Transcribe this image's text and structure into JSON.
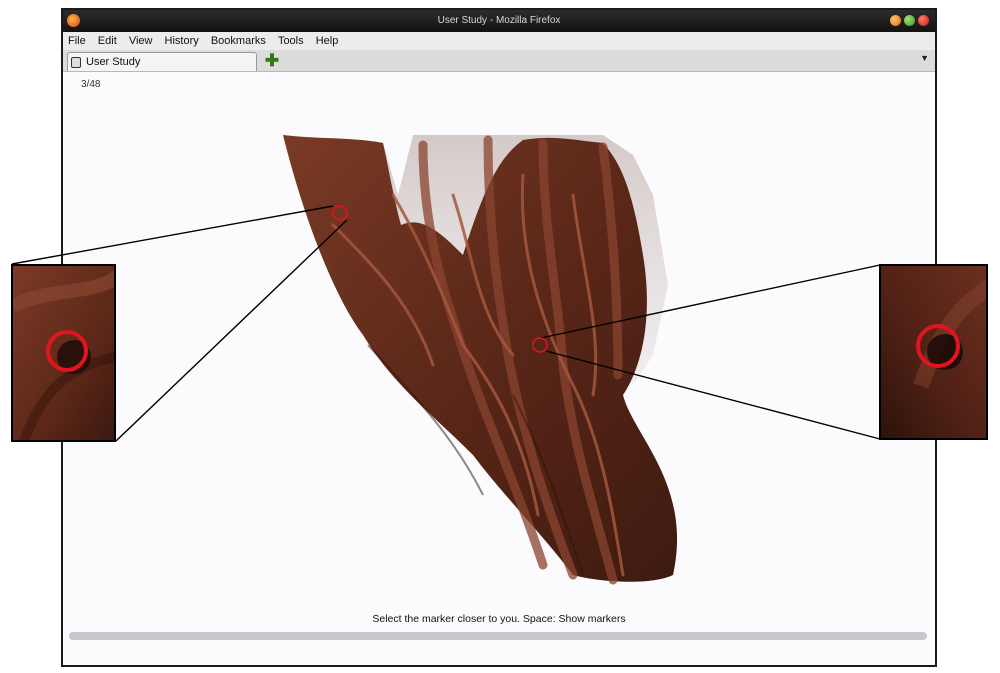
{
  "window": {
    "title": "User Study - Mozilla Firefox"
  },
  "menubar": {
    "items": [
      "File",
      "Edit",
      "View",
      "History",
      "Bookmarks",
      "Tools",
      "Help"
    ]
  },
  "tabs": [
    {
      "label": "User Study",
      "icon": "page-icon",
      "active": true
    }
  ],
  "page": {
    "progress_counter": "3/48",
    "instructions": "Select the marker closer to you. Space: Show markers",
    "progress_fraction": 0.0625
  },
  "colors": {
    "marker": "#e0141e",
    "tissue": "#5a2718",
    "background": "#fbfbfd"
  }
}
